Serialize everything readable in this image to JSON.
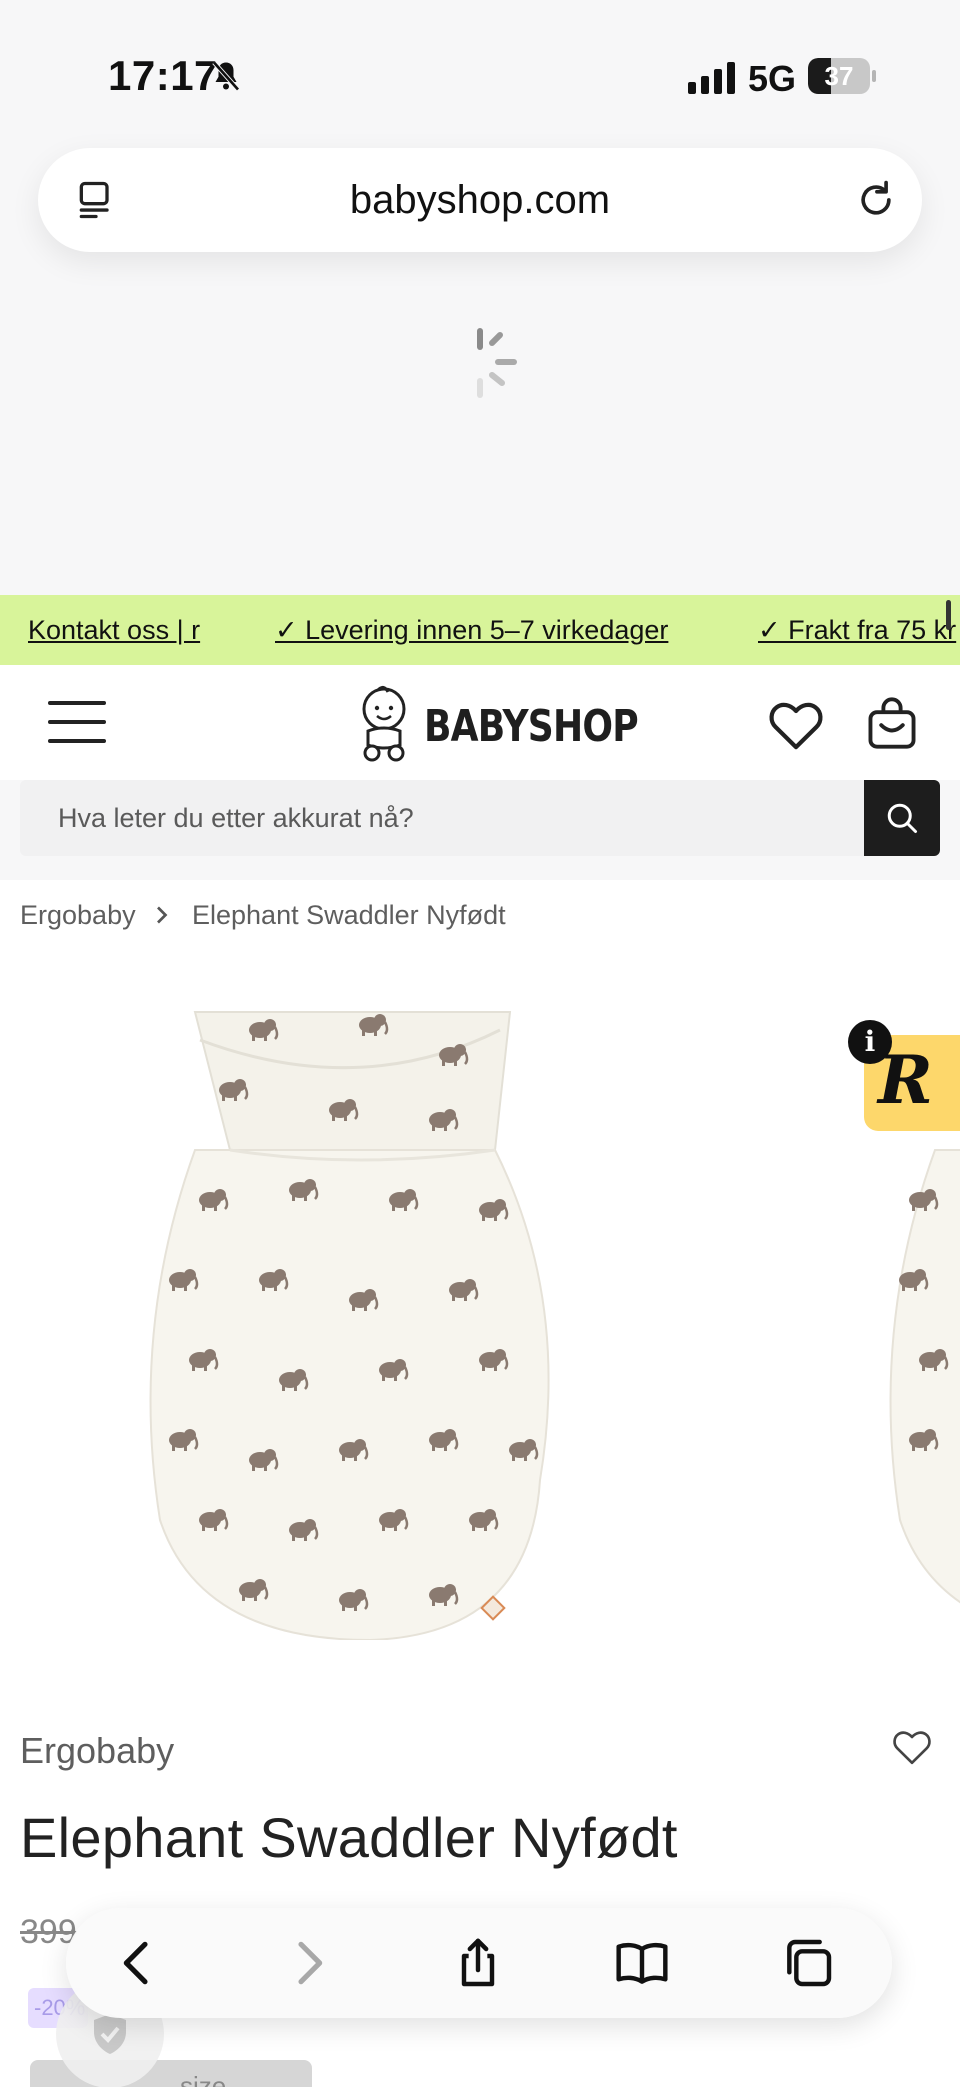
{
  "status_bar": {
    "time": "17:17",
    "network": "5G",
    "battery_percent": "37",
    "battery_level": 0.37,
    "icons": [
      "bell-slash-icon",
      "signal-icon",
      "battery-icon"
    ]
  },
  "browser": {
    "url": "babyshop.com"
  },
  "promo_bar": {
    "items": [
      "Kontakt oss | r",
      "✓ Levering innen 5–7 virkedager",
      "✓ Frakt fra 75 kr"
    ],
    "background": "#d8f49a"
  },
  "header": {
    "logo_text": "BABYSHOP",
    "icons": [
      "menu-icon",
      "heart-icon",
      "cart-icon"
    ]
  },
  "search": {
    "placeholder": "Hva leter du etter akkurat nå?"
  },
  "breadcrumb": {
    "items": [
      "Ergobaby",
      "Elephant Swaddler Nyfødt"
    ]
  },
  "product": {
    "brand": "Ergobaby",
    "title": "Elephant Swaddler Nyfødt",
    "old_price": "399",
    "discount": "-20%",
    "size_button": "size",
    "badge_letter": "R",
    "badge_info": "i"
  },
  "colors": {
    "accent_green": "#d8f49a",
    "badge_yellow": "#fdd76b",
    "dark": "#1d1d1d"
  }
}
